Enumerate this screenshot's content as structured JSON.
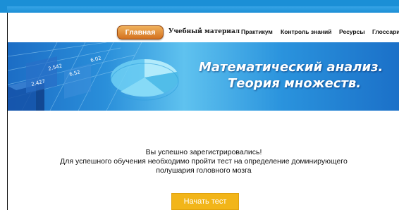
{
  "nav": {
    "home": "Главная",
    "items": [
      "Учебный материал",
      "Практикум",
      "Контроль знаний",
      "Ресурсы",
      "Глоссарий"
    ]
  },
  "banner": {
    "title_line1": "Математический анализ.",
    "title_line2": "Теория множеств.",
    "chart_labels": [
      "2.427",
      "2.542",
      "6.52",
      "6.02"
    ]
  },
  "message": {
    "line1": "Вы успешно зарегистрировались!",
    "line2": "Для успешного обучения необходимо пройти тест на определение доминирующего",
    "line3": "полушария головного мозга"
  },
  "start_button": "Начать тест",
  "colors": {
    "top_bar": "#1b8fd6",
    "home_tab": "#e08a2c",
    "start_button": "#f2b519"
  }
}
